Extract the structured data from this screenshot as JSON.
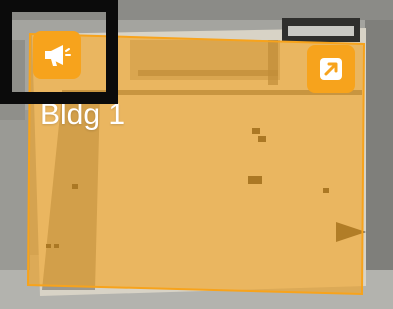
{
  "building": {
    "label": "Bldg 1",
    "overlay_color": "#f7a31c"
  },
  "buttons": {
    "announce_icon": "megaphone-icon",
    "expand_icon": "arrow-up-right-icon",
    "button_color": "#f7a31c"
  },
  "selection": {
    "frame_color": "#0b0b0b"
  }
}
